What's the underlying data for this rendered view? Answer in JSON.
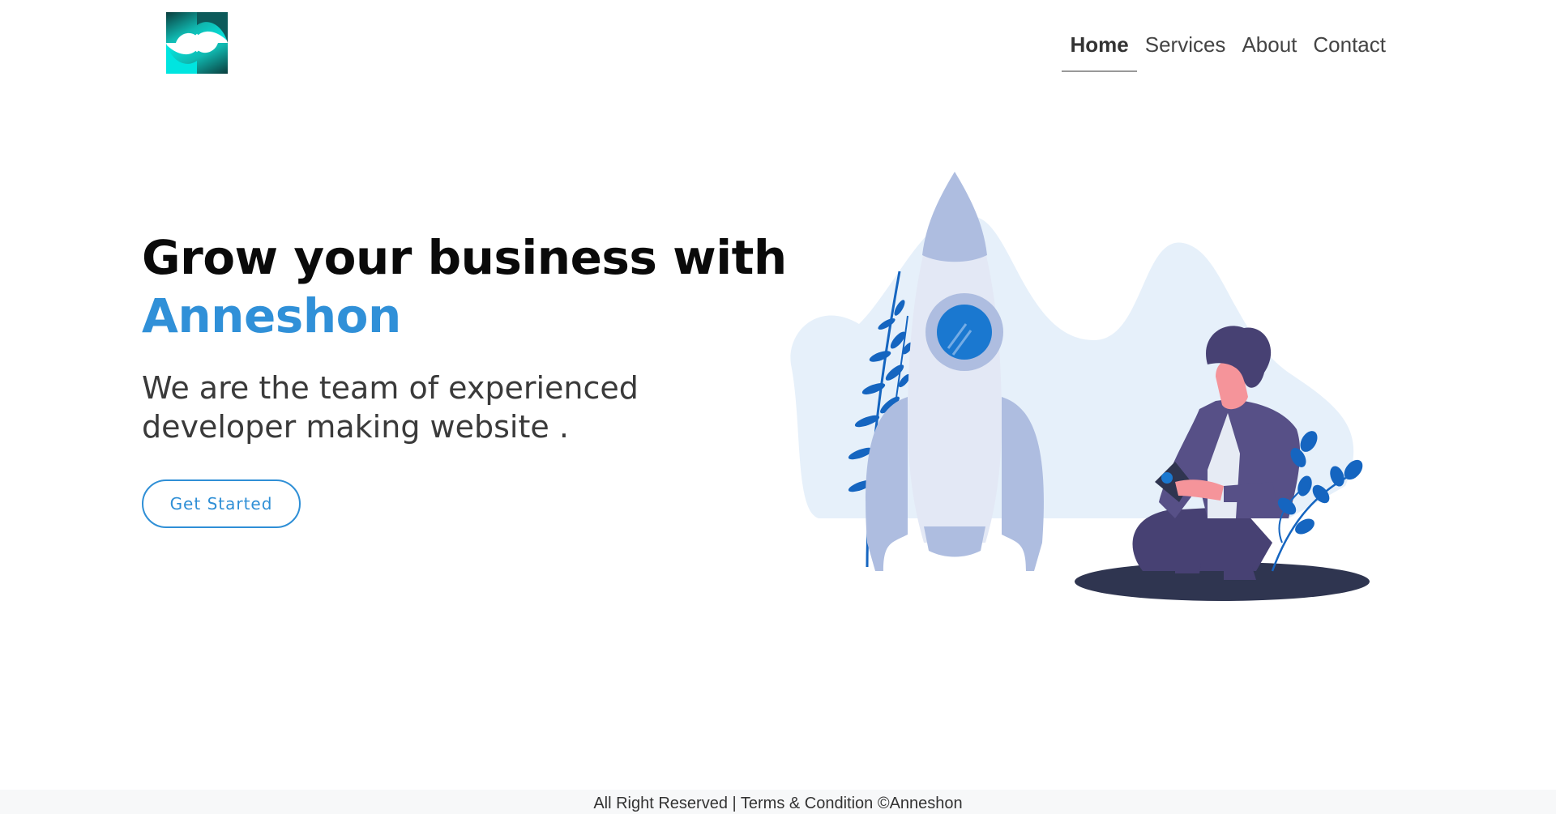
{
  "header": {
    "logo_icon": "swirl-logo-icon",
    "nav": [
      {
        "label": "Home",
        "active": true
      },
      {
        "label": "Services",
        "active": false
      },
      {
        "label": "About",
        "active": false
      },
      {
        "label": "Contact",
        "active": false
      }
    ]
  },
  "hero": {
    "title_line1": "Grow your business with",
    "title_brand": "Anneshon",
    "subtitle_line1": "We are the team of experienced",
    "subtitle_line2": "developer making website .",
    "cta_label": "Get Started"
  },
  "footer": {
    "text": "All Right Reserved | Terms & Condition ©Anneshon"
  },
  "colors": {
    "brand": "#3090d8",
    "logo_teal": "#00e5e0",
    "illustration_accent": "#1565c0"
  }
}
